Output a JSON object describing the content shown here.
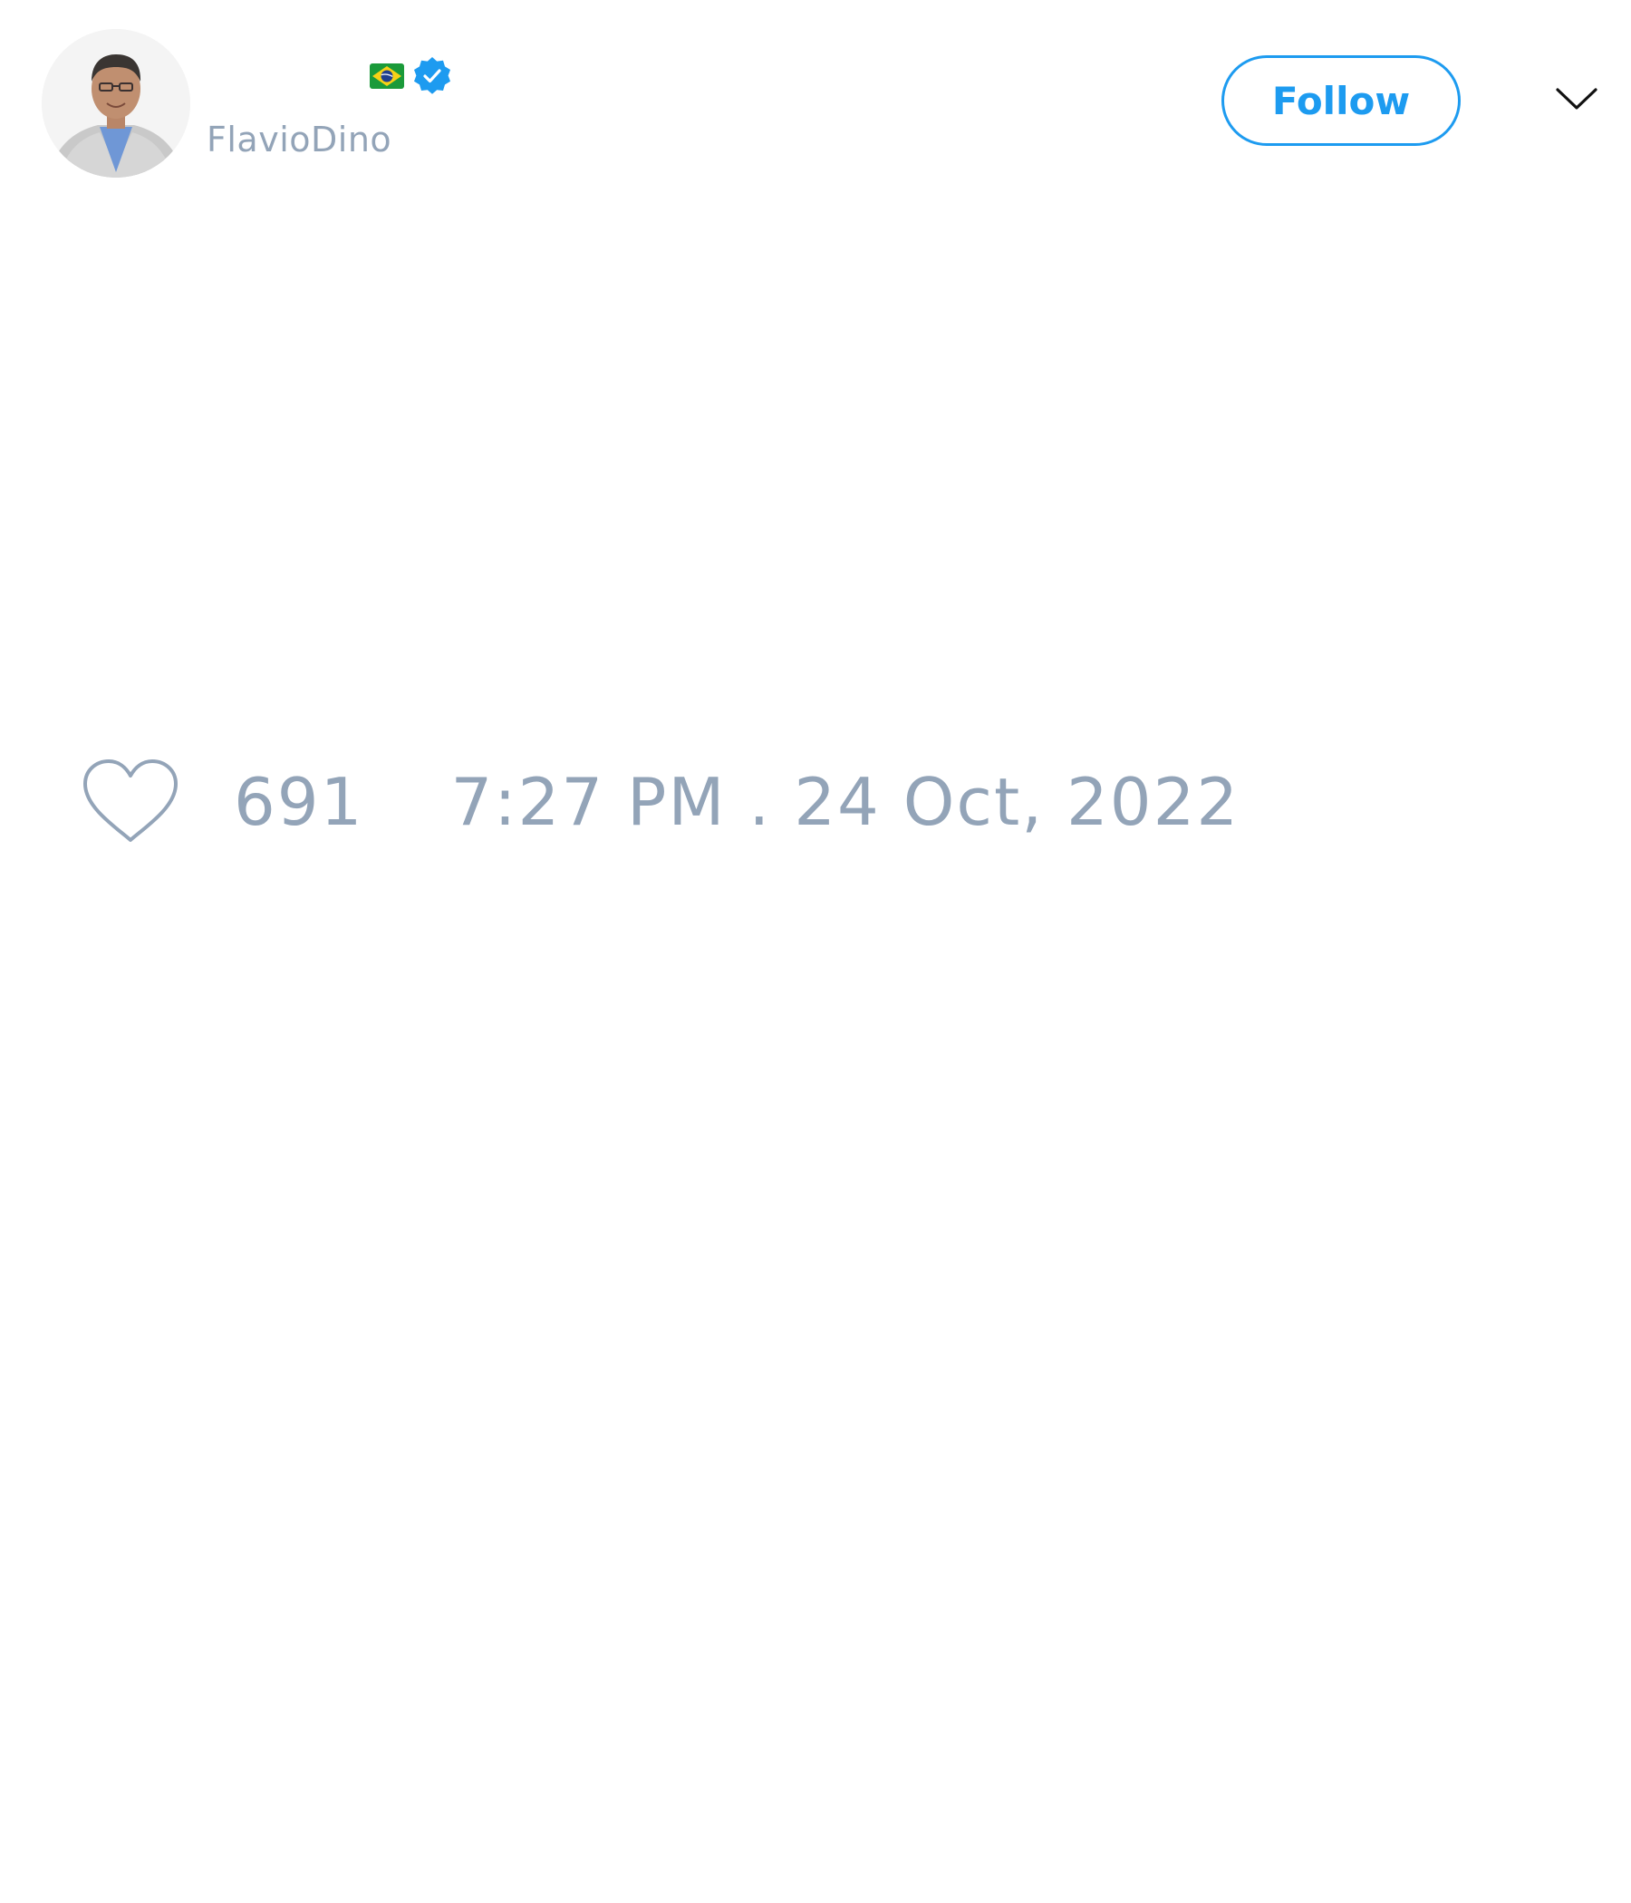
{
  "profile": {
    "display_name_emoji": "flag-brazil-icon",
    "verified_badge": "verified-badge-icon",
    "handle": "FlavioDino",
    "avatar": "profile-avatar-photo"
  },
  "actions": {
    "follow_label": "Follow",
    "more_menu_icon": "chevron-down-icon"
  },
  "tweet": {
    "like_icon": "heart-icon",
    "like_count": "691",
    "timestamp": "7:27 PM . 24 Oct, 2022"
  },
  "colors": {
    "accent": "#1d9bf0",
    "muted_text": "#93a4b8",
    "background": "#ffffff"
  }
}
